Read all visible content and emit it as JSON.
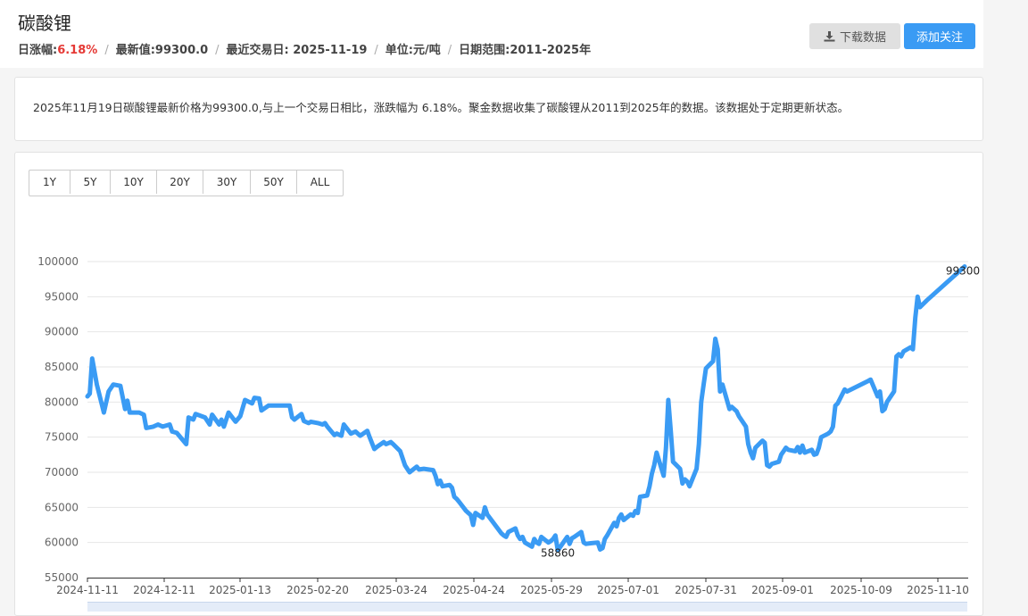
{
  "header": {
    "title": "碳酸锂",
    "change_label": "日涨幅:",
    "change_value": "6.18%",
    "latest_label": "最新值:",
    "latest_value": "99300.0",
    "trade_date_label": "最近交易日:",
    "trade_date_value": "2025-11-19",
    "unit_label": "单位:",
    "unit_value": "元/吨",
    "range_label": "日期范围:",
    "range_value": "2011-2025年",
    "download_label": "下载数据",
    "follow_label": "添加关注"
  },
  "description": "2025年11月19日碳酸锂最新价格为99300.0,与上一个交易日相比，涨跌幅为 6.18%。聚金数据收集了碳酸锂从2011到2025年的数据。该数据处于定期更新状态。",
  "range_buttons": [
    "1Y",
    "5Y",
    "10Y",
    "20Y",
    "30Y",
    "50Y",
    "ALL"
  ],
  "colors": {
    "accent": "#3a9bf4",
    "line": "#3a9bf4",
    "up": "#e53935"
  },
  "chart_data": {
    "type": "line",
    "title": "",
    "xlabel": "",
    "ylabel": "",
    "ylim": [
      55000,
      100000
    ],
    "yticks": [
      "55000",
      "60000",
      "65000",
      "70000",
      "75000",
      "80000",
      "85000",
      "90000",
      "95000",
      "100000"
    ],
    "xticks": [
      "2024-11-11",
      "2024-12-11",
      "2025-01-13",
      "2025-02-20",
      "2025-03-24",
      "2025-04-24",
      "2025-05-29",
      "2025-07-01",
      "2025-07-31",
      "2025-09-01",
      "2025-10-09",
      "2025-11-10"
    ],
    "grid": true,
    "legend": "none",
    "annotations": [
      {
        "date": "2025-05-30",
        "value": 58860,
        "text": "58860"
      },
      {
        "date": "2025-11-19",
        "value": 99300,
        "text": "99300"
      }
    ],
    "series": [
      {
        "values": [
          [
            "2024-11-11",
            80800
          ],
          [
            "2024-11-12",
            81200
          ],
          [
            "2024-11-13",
            86200
          ],
          [
            "2024-11-15",
            82500
          ],
          [
            "2024-11-18",
            78500
          ],
          [
            "2024-11-20",
            81500
          ],
          [
            "2024-11-22",
            82500
          ],
          [
            "2024-11-25",
            82300
          ],
          [
            "2024-11-27",
            79000
          ],
          [
            "2024-11-28",
            80200
          ],
          [
            "2024-11-29",
            78500
          ],
          [
            "2024-12-03",
            78500
          ],
          [
            "2024-12-05",
            78200
          ],
          [
            "2024-12-06",
            76300
          ],
          [
            "2024-12-09",
            76500
          ],
          [
            "2024-12-11",
            76800
          ],
          [
            "2024-12-13",
            76500
          ],
          [
            "2024-12-16",
            76800
          ],
          [
            "2024-12-17",
            75800
          ],
          [
            "2024-12-19",
            75600
          ],
          [
            "2024-12-23",
            74000
          ],
          [
            "2024-12-24",
            77800
          ],
          [
            "2024-12-26",
            77500
          ],
          [
            "2024-12-27",
            78300
          ],
          [
            "2024-12-31",
            77800
          ],
          [
            "2025-01-02",
            76800
          ],
          [
            "2025-01-03",
            78200
          ],
          [
            "2025-01-06",
            76800
          ],
          [
            "2025-01-07",
            77500
          ],
          [
            "2025-01-08",
            76500
          ],
          [
            "2025-01-10",
            78500
          ],
          [
            "2025-01-13",
            77200
          ],
          [
            "2025-01-15",
            78000
          ],
          [
            "2025-01-17",
            80300
          ],
          [
            "2025-01-20",
            79800
          ],
          [
            "2025-01-21",
            80600
          ],
          [
            "2025-01-23",
            80500
          ],
          [
            "2025-01-24",
            78800
          ],
          [
            "2025-01-27",
            79500
          ],
          [
            "2025-02-05",
            79500
          ],
          [
            "2025-02-06",
            77800
          ],
          [
            "2025-02-07",
            77500
          ],
          [
            "2025-02-10",
            78300
          ],
          [
            "2025-02-11",
            77300
          ],
          [
            "2025-02-13",
            77000
          ],
          [
            "2025-02-14",
            77200
          ],
          [
            "2025-02-17",
            77000
          ],
          [
            "2025-02-19",
            76800
          ],
          [
            "2025-02-20",
            77000
          ],
          [
            "2025-02-21",
            76500
          ],
          [
            "2025-02-24",
            75300
          ],
          [
            "2025-02-25",
            75500
          ],
          [
            "2025-02-27",
            75200
          ],
          [
            "2025-02-28",
            76800
          ],
          [
            "2025-03-03",
            75500
          ],
          [
            "2025-03-05",
            75800
          ],
          [
            "2025-03-07",
            75200
          ],
          [
            "2025-03-10",
            75900
          ],
          [
            "2025-03-11",
            75000
          ],
          [
            "2025-03-13",
            73300
          ],
          [
            "2025-03-14",
            73600
          ],
          [
            "2025-03-17",
            74300
          ],
          [
            "2025-03-18",
            74000
          ],
          [
            "2025-03-20",
            74300
          ],
          [
            "2025-03-21",
            74000
          ],
          [
            "2025-03-24",
            73000
          ],
          [
            "2025-03-26",
            71000
          ],
          [
            "2025-03-27",
            70500
          ],
          [
            "2025-03-28",
            70000
          ],
          [
            "2025-03-31",
            70800
          ],
          [
            "2025-04-01",
            70400
          ],
          [
            "2025-04-03",
            70500
          ],
          [
            "2025-04-07",
            70300
          ],
          [
            "2025-04-08",
            69500
          ],
          [
            "2025-04-09",
            68300
          ],
          [
            "2025-04-10",
            68800
          ],
          [
            "2025-04-11",
            68000
          ],
          [
            "2025-04-14",
            68200
          ],
          [
            "2025-04-15",
            67800
          ],
          [
            "2025-04-16",
            66500
          ],
          [
            "2025-04-17",
            66200
          ],
          [
            "2025-04-18",
            65800
          ],
          [
            "2025-04-21",
            64500
          ],
          [
            "2025-04-22",
            64200
          ],
          [
            "2025-04-23",
            63900
          ],
          [
            "2025-04-24",
            62500
          ],
          [
            "2025-04-25",
            64200
          ],
          [
            "2025-04-28",
            63500
          ],
          [
            "2025-04-29",
            65000
          ],
          [
            "2025-04-30",
            64000
          ],
          [
            "2025-05-06",
            61300
          ],
          [
            "2025-05-07",
            61000
          ],
          [
            "2025-05-08",
            60800
          ],
          [
            "2025-05-09",
            61500
          ],
          [
            "2025-05-12",
            62000
          ],
          [
            "2025-05-13",
            61000
          ],
          [
            "2025-05-14",
            60500
          ],
          [
            "2025-05-15",
            60800
          ],
          [
            "2025-05-16",
            60000
          ],
          [
            "2025-05-19",
            59400
          ],
          [
            "2025-05-20",
            60500
          ],
          [
            "2025-05-21",
            60000
          ],
          [
            "2025-05-22",
            59800
          ],
          [
            "2025-05-23",
            60800
          ],
          [
            "2025-05-26",
            60000
          ],
          [
            "2025-05-27",
            60200
          ],
          [
            "2025-05-28",
            60500
          ],
          [
            "2025-05-29",
            61000
          ],
          [
            "2025-05-30",
            58860
          ],
          [
            "2025-06-03",
            60800
          ],
          [
            "2025-06-04",
            59800
          ],
          [
            "2025-06-05",
            60600
          ],
          [
            "2025-06-06",
            60800
          ],
          [
            "2025-06-09",
            61500
          ],
          [
            "2025-06-10",
            60000
          ],
          [
            "2025-06-11",
            59800
          ],
          [
            "2025-06-13",
            59900
          ],
          [
            "2025-06-16",
            60000
          ],
          [
            "2025-06-17",
            59000
          ],
          [
            "2025-06-18",
            59200
          ],
          [
            "2025-06-19",
            60500
          ],
          [
            "2025-06-20",
            61000
          ],
          [
            "2025-06-23",
            62800
          ],
          [
            "2025-06-24",
            62300
          ],
          [
            "2025-06-25",
            63500
          ],
          [
            "2025-06-26",
            64000
          ],
          [
            "2025-06-27",
            63200
          ],
          [
            "2025-06-30",
            64000
          ],
          [
            "2025-07-01",
            63800
          ],
          [
            "2025-07-02",
            64500
          ],
          [
            "2025-07-03",
            64200
          ],
          [
            "2025-07-04",
            66500
          ],
          [
            "2025-07-07",
            66700
          ],
          [
            "2025-07-08",
            68000
          ],
          [
            "2025-07-09",
            69800
          ],
          [
            "2025-07-10",
            71000
          ],
          [
            "2025-07-11",
            72800
          ],
          [
            "2025-07-14",
            69500
          ],
          [
            "2025-07-15",
            73500
          ],
          [
            "2025-07-16",
            80300
          ],
          [
            "2025-07-17",
            76000
          ],
          [
            "2025-07-18",
            71500
          ],
          [
            "2025-07-21",
            70500
          ],
          [
            "2025-07-22",
            68400
          ],
          [
            "2025-07-23",
            69000
          ],
          [
            "2025-07-24",
            68700
          ],
          [
            "2025-07-25",
            68000
          ],
          [
            "2025-07-28",
            70500
          ],
          [
            "2025-07-29",
            74000
          ],
          [
            "2025-07-30",
            80000
          ],
          [
            "2025-07-31",
            82500
          ],
          [
            "2025-08-01",
            84800
          ],
          [
            "2025-08-04",
            85800
          ],
          [
            "2025-08-05",
            89000
          ],
          [
            "2025-08-06",
            87500
          ],
          [
            "2025-08-07",
            81500
          ],
          [
            "2025-08-08",
            82500
          ],
          [
            "2025-08-11",
            79000
          ],
          [
            "2025-08-12",
            79300
          ],
          [
            "2025-08-13",
            79000
          ],
          [
            "2025-08-14",
            78700
          ],
          [
            "2025-08-15",
            78000
          ],
          [
            "2025-08-18",
            76500
          ],
          [
            "2025-08-19",
            74000
          ],
          [
            "2025-08-20",
            72800
          ],
          [
            "2025-08-21",
            72000
          ],
          [
            "2025-08-22",
            73500
          ],
          [
            "2025-08-25",
            74500
          ],
          [
            "2025-08-26",
            74200
          ],
          [
            "2025-08-27",
            71000
          ],
          [
            "2025-08-28",
            70800
          ],
          [
            "2025-08-29",
            71200
          ],
          [
            "2025-09-01",
            71500
          ],
          [
            "2025-09-02",
            72500
          ],
          [
            "2025-09-03",
            73000
          ],
          [
            "2025-09-04",
            73500
          ],
          [
            "2025-09-05",
            73200
          ],
          [
            "2025-09-08",
            73000
          ],
          [
            "2025-09-09",
            73600
          ],
          [
            "2025-09-10",
            72800
          ],
          [
            "2025-09-11",
            73800
          ],
          [
            "2025-09-12",
            72800
          ],
          [
            "2025-09-15",
            73200
          ],
          [
            "2025-09-16",
            72500
          ],
          [
            "2025-09-17",
            72600
          ],
          [
            "2025-09-18",
            73500
          ],
          [
            "2025-09-19",
            75000
          ],
          [
            "2025-09-22",
            75500
          ],
          [
            "2025-09-23",
            75800
          ],
          [
            "2025-09-24",
            76500
          ],
          [
            "2025-09-25",
            79500
          ],
          [
            "2025-09-26",
            79800
          ],
          [
            "2025-09-29",
            81800
          ],
          [
            "2025-09-30",
            81500
          ],
          [
            "2025-10-09",
            83000
          ],
          [
            "2025-10-10",
            83200
          ],
          [
            "2025-10-13",
            80800
          ],
          [
            "2025-10-14",
            81500
          ],
          [
            "2025-10-15",
            78700
          ],
          [
            "2025-10-16",
            79000
          ],
          [
            "2025-10-17",
            80000
          ],
          [
            "2025-10-20",
            81500
          ],
          [
            "2025-10-21",
            86500
          ],
          [
            "2025-10-22",
            86800
          ],
          [
            "2025-10-23",
            86500
          ],
          [
            "2025-10-24",
            87200
          ],
          [
            "2025-10-27",
            87800
          ],
          [
            "2025-10-28",
            87500
          ],
          [
            "2025-10-29",
            92000
          ],
          [
            "2025-10-30",
            95000
          ],
          [
            "2025-10-31",
            93500
          ],
          [
            "2025-11-03",
            94500
          ],
          [
            "2025-11-19",
            99300
          ]
        ]
      }
    ]
  }
}
